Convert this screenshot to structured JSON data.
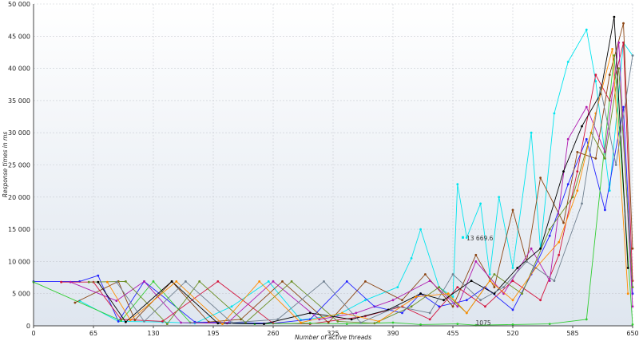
{
  "chart_data": {
    "type": "line",
    "xlabel": "Number of active threads",
    "ylabel": "Response times in ms",
    "xlim": [
      0,
      650
    ],
    "ylim": [
      0,
      50000
    ],
    "x_ticks": [
      0,
      65,
      130,
      195,
      260,
      325,
      390,
      455,
      520,
      585,
      650
    ],
    "y_ticks": [
      0,
      5000,
      10000,
      15000,
      20000,
      25000,
      30000,
      35000,
      40000,
      45000,
      50000
    ],
    "y_tick_labels": [
      "0",
      "5 000",
      "10 000",
      "15 000",
      "20 000",
      "25 000",
      "30 000",
      "35 000",
      "40 000",
      "45 000",
      "50 000"
    ],
    "grid": true,
    "legend": "none",
    "annotations": [
      {
        "text": "13 669.6",
        "x": 468,
        "y": 13670
      },
      {
        "text": "1075",
        "x": 478,
        "y": 0
      }
    ],
    "series": [
      {
        "color": "#00e5ee",
        "x": [
          50,
          92,
          140,
          175,
          215,
          255,
          290,
          330,
          360,
          395,
          410,
          420,
          440,
          455,
          460,
          470,
          485,
          495,
          505,
          520,
          540,
          550,
          565,
          580,
          600,
          610,
          625,
          640,
          650
        ],
        "y": [
          3900,
          700,
          600,
          400,
          3000,
          6900,
          900,
          1700,
          4000,
          6000,
          10500,
          15000,
          6000,
          4500,
          22000,
          13700,
          19000,
          8000,
          20000,
          9000,
          30000,
          12000,
          33000,
          41000,
          46000,
          38000,
          21000,
          44000,
          42000
        ]
      },
      {
        "color": "#2222ff",
        "x": [
          0,
          50,
          70,
          92,
          120,
          175,
          215,
          260,
          300,
          340,
          370,
          400,
          420,
          440,
          470,
          490,
          520,
          540,
          560,
          580,
          600,
          620,
          640,
          650
        ],
        "y": [
          6900,
          6900,
          7800,
          700,
          6900,
          600,
          500,
          400,
          1000,
          6900,
          3000,
          2000,
          5000,
          3000,
          4000,
          6000,
          2500,
          8000,
          14000,
          22000,
          29000,
          18000,
          34000,
          5000
        ]
      },
      {
        "color": "#d4143c",
        "x": [
          30,
          65,
          95,
          140,
          200,
          260,
          300,
          360,
          400,
          430,
          460,
          490,
          520,
          550,
          570,
          590,
          610,
          625,
          640,
          650
        ],
        "y": [
          6800,
          6800,
          1000,
          700,
          6900,
          400,
          300,
          1500,
          3000,
          1000,
          6000,
          3000,
          7000,
          4000,
          11000,
          24000,
          39000,
          35000,
          44000,
          7000
        ]
      },
      {
        "color": "#32cd32",
        "x": [
          0,
          95,
          130,
          170,
          240,
          300,
          340,
          390,
          420,
          460,
          480,
          520,
          560,
          600,
          630,
          650
        ],
        "y": [
          6800,
          800,
          6900,
          500,
          300,
          400,
          300,
          500,
          200,
          300,
          100,
          200,
          300,
          1000,
          42000,
          200
        ]
      },
      {
        "color": "#8b4513",
        "x": [
          45,
          92,
          110,
          150,
          190,
          225,
          270,
          320,
          360,
          400,
          425,
          455,
          480,
          500,
          520,
          535,
          550,
          575,
          590,
          610,
          625,
          640,
          650
        ],
        "y": [
          3600,
          6900,
          900,
          6900,
          600,
          1000,
          6900,
          500,
          6900,
          4000,
          8000,
          3000,
          11000,
          6000,
          18000,
          10000,
          23000,
          16000,
          27000,
          26000,
          39000,
          47000,
          12000
        ]
      },
      {
        "color": "#b01cb0",
        "x": [
          40,
          90,
          120,
          160,
          210,
          260,
          310,
          350,
          390,
          430,
          460,
          480,
          510,
          540,
          560,
          580,
          600,
          620,
          635,
          650
        ],
        "y": [
          6800,
          3900,
          6900,
          500,
          400,
          6900,
          1000,
          2000,
          4000,
          7000,
          3000,
          10000,
          5000,
          12000,
          7000,
          29000,
          34000,
          27000,
          44000,
          3000
        ]
      },
      {
        "color": "#6b8e23",
        "x": [
          60,
          100,
          145,
          180,
          230,
          280,
          330,
          370,
          410,
          440,
          470,
          500,
          530,
          560,
          585,
          605,
          620,
          635,
          650
        ],
        "y": [
          6800,
          6900,
          300,
          6900,
          500,
          6900,
          700,
          400,
          3000,
          6000,
          2000,
          8000,
          5000,
          15000,
          20000,
          30000,
          26000,
          40000,
          6000
        ]
      },
      {
        "color": "#000000",
        "x": [
          70,
          100,
          150,
          200,
          250,
          300,
          345,
          385,
          420,
          445,
          475,
          500,
          525,
          550,
          575,
          595,
          615,
          630,
          645
        ],
        "y": [
          6800,
          600,
          6900,
          400,
          300,
          2000,
          1000,
          2500,
          5000,
          4000,
          7000,
          5000,
          9000,
          12000,
          24000,
          31000,
          36000,
          48000,
          9000
        ]
      },
      {
        "color": "#ff8c00",
        "x": [
          80,
          105,
          155,
          205,
          245,
          290,
          335,
          375,
          415,
          450,
          470,
          495,
          520,
          545,
          570,
          590,
          610,
          628,
          645
        ],
        "y": [
          6800,
          900,
          6900,
          300,
          6900,
          500,
          2000,
          700,
          4500,
          5000,
          2000,
          7000,
          4000,
          9000,
          13000,
          21000,
          33000,
          43000,
          5000
        ]
      },
      {
        "color": "#708090",
        "x": [
          90,
          120,
          165,
          215,
          265,
          315,
          355,
          395,
          430,
          455,
          485,
          510,
          535,
          565,
          595,
          615,
          632,
          650
        ],
        "y": [
          6800,
          700,
          6900,
          500,
          1000,
          6900,
          500,
          3000,
          2000,
          8000,
          4000,
          6000,
          10000,
          7000,
          19000,
          37000,
          25000,
          42000
        ]
      }
    ]
  }
}
